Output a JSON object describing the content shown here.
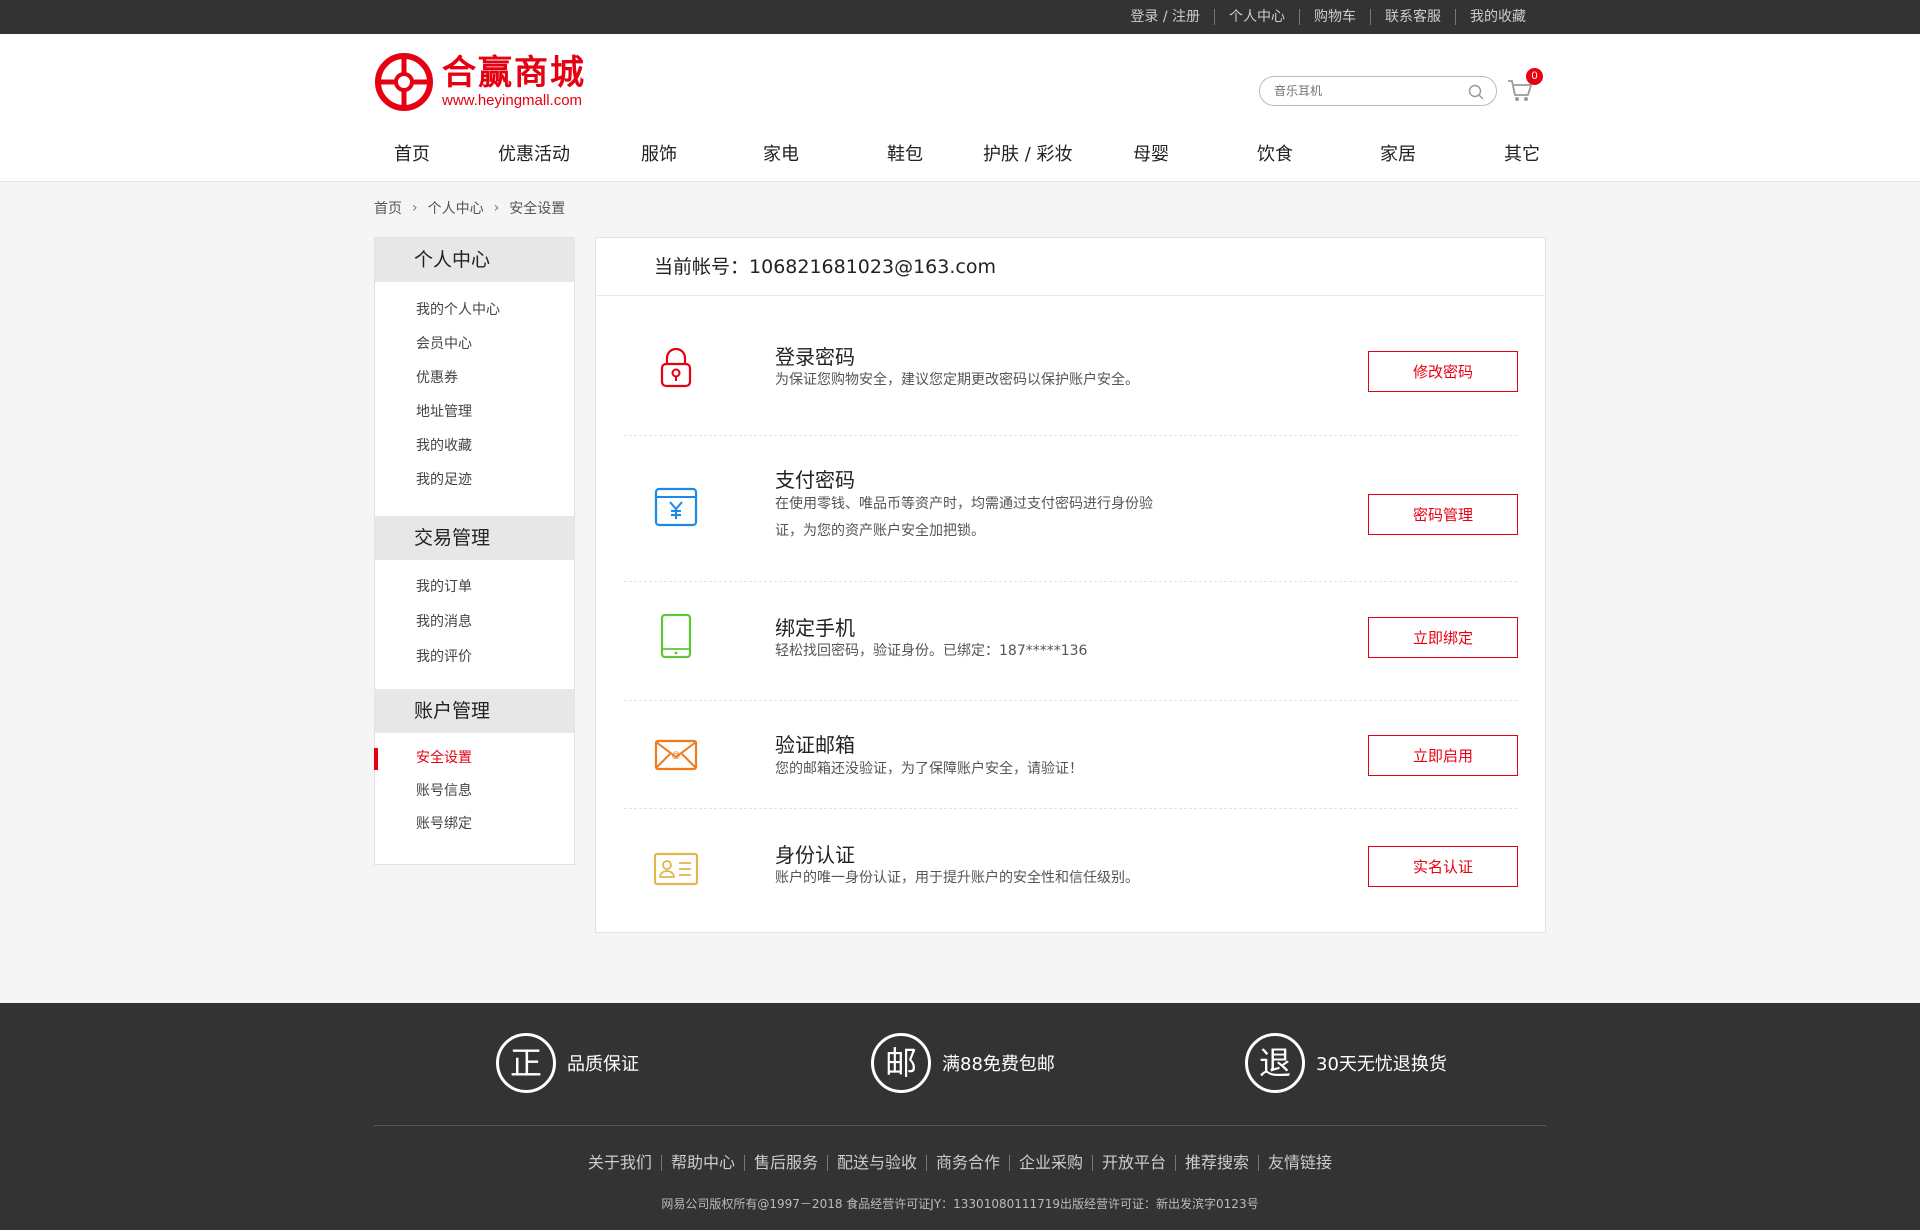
{
  "topbar": {
    "links": [
      "登录 / 注册",
      "个人中心",
      "购物车",
      "联系客服",
      "我的收藏"
    ]
  },
  "header": {
    "logo_cn": "合赢商城",
    "logo_url": "www.heyingmall.com",
    "search_placeholder": "音乐耳机",
    "cart_count": "0"
  },
  "nav": [
    "首页",
    "优惠活动",
    "服饰",
    "家电",
    "鞋包",
    "护肤 / 彩妆",
    "母婴",
    "饮食",
    "家居",
    "其它"
  ],
  "breadcrumb": [
    "首页",
    "个人中心",
    "安全设置"
  ],
  "sidebar": {
    "groups": [
      {
        "title": "个人中心",
        "items": [
          "我的个人中心",
          "会员中心",
          "优惠券",
          "地址管理",
          "我的收藏",
          "我的足迹"
        ]
      },
      {
        "title": "交易管理",
        "items": [
          "我的订单",
          "我的消息",
          "我的评价"
        ]
      },
      {
        "title": "账户管理",
        "items": [
          "安全设置",
          "账号信息",
          "账号绑定"
        ]
      }
    ],
    "active_item": "安全设置"
  },
  "main": {
    "account_label": "当前帐号：",
    "account_value": "106821681023@163.com",
    "rows": [
      {
        "icon": "lock-icon",
        "color": "#e60012",
        "title": "登录密码",
        "desc": "为保证您购物安全，建议您定期更改密码以保护账户安全。",
        "button": "修改密码"
      },
      {
        "icon": "payment-yen-icon",
        "color": "#1e88e5",
        "title": "支付密码",
        "desc": "在使用零钱、唯品币等资产时，均需通过支付密码进行身份验证，为您的资产账户安全加把锁。",
        "button": "密码管理"
      },
      {
        "icon": "phone-icon",
        "color": "#5cc736",
        "title": "绑定手机",
        "desc": "轻松找回密码，验证身份。已绑定：187*****136",
        "button": "立即绑定"
      },
      {
        "icon": "email-icon",
        "color": "#f07b1f",
        "title": "验证邮箱",
        "desc": "您的邮箱还没验证，为了保障账户安全，请验证！",
        "button": "立即启用"
      },
      {
        "icon": "id-card-icon",
        "color": "#e0b84a",
        "title": "身份认证",
        "desc": "账户的唯一身份认证，用于提升账户的安全性和信任级别。",
        "button": "实名认证"
      }
    ]
  },
  "footer": {
    "promises": [
      {
        "char": "正",
        "text": "品质保证"
      },
      {
        "char": "邮",
        "text": "满88免费包邮"
      },
      {
        "char": "退",
        "text": "30天无忧退换货"
      }
    ],
    "links": [
      "关于我们",
      "帮助中心",
      "售后服务",
      "配送与验收",
      "商务合作",
      "企业采购",
      "开放平台",
      "推荐搜索",
      "友情链接"
    ],
    "copyright": "网易公司版权所有@1997－2018   食品经营许可证JY：13301080111719出版经营许可证：新出发滨字0123号"
  }
}
